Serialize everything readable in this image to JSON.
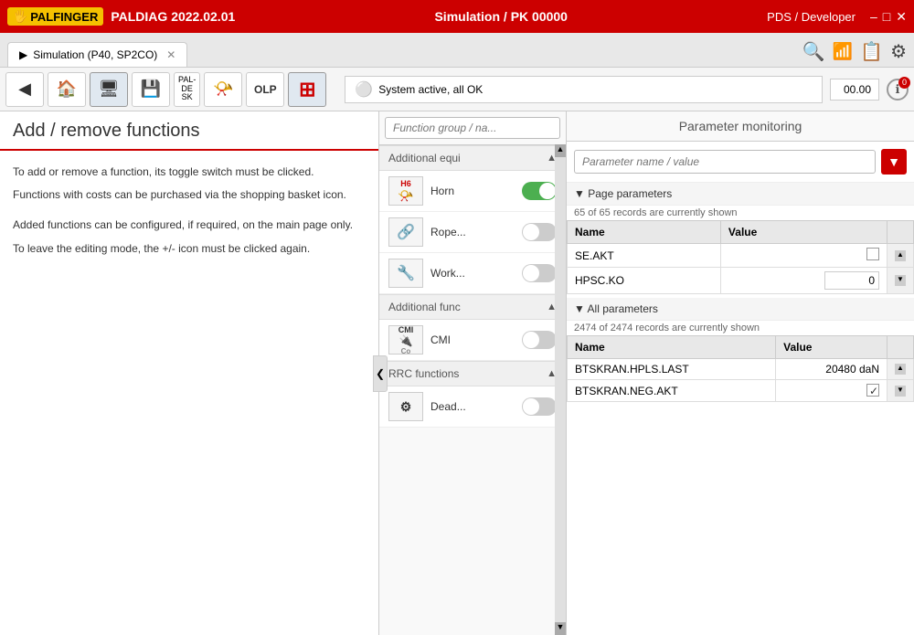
{
  "titlebar": {
    "logo": "PALFINGER",
    "app_name": "PALDIAG 2022.02.01",
    "center": "Simulation / PK 00000",
    "right": "PDS / Developer",
    "min": "–",
    "max": "□",
    "close": "✕"
  },
  "tabbar": {
    "tab_label": "Simulation (P40, SP2CO)",
    "tab_close": "✕"
  },
  "toolbar": {
    "back_icon": "◀",
    "home_icon": "⌂",
    "monitor_icon": "▣",
    "save_icon": "💾",
    "pal_de_sk": "PAL-\nDE\nSK",
    "horn_icon": "🎺",
    "olp": "OLP",
    "add_remove_icon": "⊞",
    "status_text": "System active, all OK",
    "status_value": "00.00",
    "info_badge": "0"
  },
  "left_panel": {
    "title": "Add / remove functions",
    "body_p1": "To add or remove a function, its toggle switch must be clicked.",
    "body_p2": "Functions with costs can be purchased via the shopping basket icon.",
    "body_p3": "Added functions can be configured, if required, on the main page only.",
    "body_p4": "To leave the editing mode, the +/- icon must be clicked again.",
    "collapse_btn": "❮"
  },
  "middle_panel": {
    "search_placeholder": "Function group / na...",
    "groups": [
      {
        "label": "Additional equi",
        "expanded": true,
        "items": [
          {
            "icon": "H6",
            "icon_sub": "horn",
            "label": "Horn",
            "toggle": "on"
          },
          {
            "icon": "rope",
            "label": "Rope...",
            "toggle": "off"
          },
          {
            "icon": "work",
            "label": "Work...",
            "toggle": "off"
          }
        ]
      },
      {
        "label": "Additional func",
        "expanded": true,
        "items": [
          {
            "icon": "CMI",
            "icon_sub": "cmi",
            "label": "CMI",
            "toggle": "off"
          }
        ]
      },
      {
        "label": "RRC functions",
        "expanded": true,
        "items": [
          {
            "icon": "dead",
            "label": "Dead...",
            "toggle": "off"
          }
        ]
      }
    ]
  },
  "right_panel": {
    "title": "Parameter monitoring",
    "param_search_placeholder": "Parameter name / value",
    "page_params": {
      "section_label": "▼ Page parameters",
      "count_label": "65 of 65 records are currently shown",
      "col_name": "Name",
      "col_value": "Value",
      "rows": [
        {
          "name": "SE.AKT",
          "value": "",
          "type": "checkbox",
          "checked": false
        },
        {
          "name": "HPSC.KO",
          "value": "0",
          "type": "input"
        }
      ]
    },
    "all_params": {
      "section_label": "▼ All parameters",
      "count_label": "2474 of 2474 records are currently shown",
      "col_name": "Name",
      "col_value": "Value",
      "rows": [
        {
          "name": "BTSKRAN.HPLS.LAST",
          "value": "20480 daN",
          "type": "text"
        },
        {
          "name": "BTSKRAN.NEG.AKT",
          "value": "",
          "type": "checkbox",
          "checked": true
        }
      ]
    }
  }
}
